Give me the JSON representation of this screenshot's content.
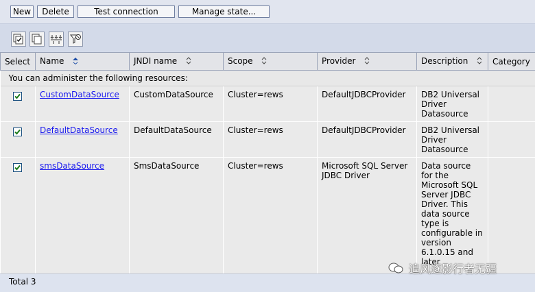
{
  "toolbar": {
    "new_label": "New",
    "delete_label": "Delete",
    "test_connection_label": "Test connection",
    "manage_state_label": "Manage state..."
  },
  "icon_toolbar": {
    "icons": [
      "select-all-icon",
      "deselect-all-icon",
      "filter-icon",
      "clear-filter-icon"
    ]
  },
  "table": {
    "columns": [
      "Select",
      "Name",
      "JNDI name",
      "Scope",
      "Provider",
      "Description",
      "Category"
    ],
    "notice": "You can administer the following resources:",
    "rows": [
      {
        "selected": true,
        "name": "CustomDataSource",
        "jndi_name": "CustomDataSource",
        "scope": "Cluster=rews",
        "provider": "DefaultJDBCProvider",
        "description": "DB2 Universal Driver Datasource",
        "category": ""
      },
      {
        "selected": true,
        "name": "DefaultDataSource",
        "jndi_name": "DefaultDataSource",
        "scope": "Cluster=rews",
        "provider": "DefaultJDBCProvider",
        "description": "DB2 Universal Driver Datasource",
        "category": ""
      },
      {
        "selected": true,
        "name": "smsDataSource",
        "jndi_name": "SmsDataSource",
        "scope": "Cluster=rews",
        "provider": "Microsoft SQL Server JDBC Driver",
        "description": "Data source for the Microsoft SQL Server JDBC Driver. This data source type is configurable in version 6.1.0.15 and later",
        "category": ""
      }
    ],
    "total": "Total 3"
  },
  "watermark": {
    "text": "追风逐影行者无疆"
  },
  "colors": {
    "link": "#1a1aee",
    "header_bg": "#e3e4e8",
    "toolbar_bg": "#d3dae9",
    "row_bg": "#eaeaea"
  }
}
